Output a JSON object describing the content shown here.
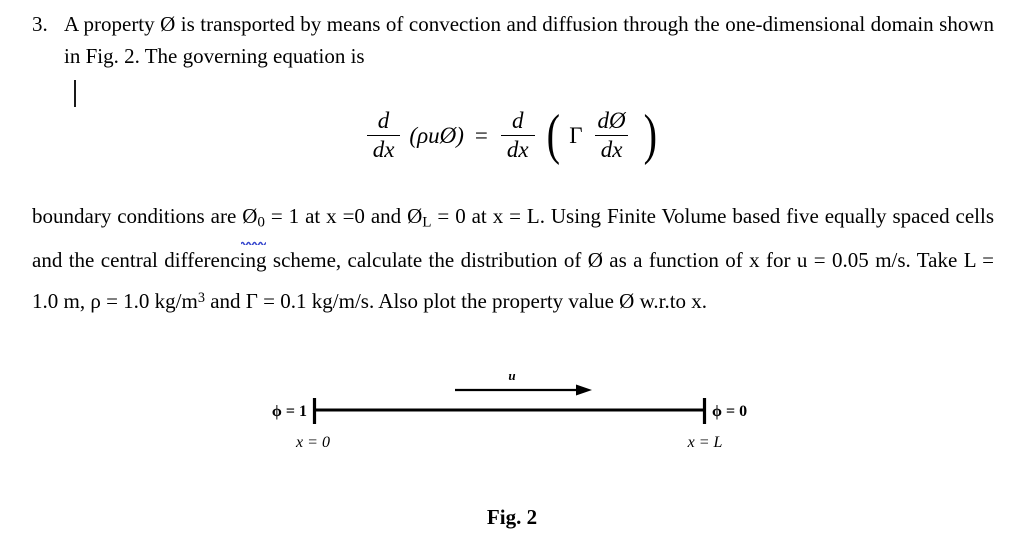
{
  "document": {
    "question_number": "3.",
    "line1": "A property Ø is transported by means of convection and diffusion through the one-dimensional domain shown in Fig. 2. The governing equation is",
    "paragraph_parts": {
      "p1": "boundary conditions are ",
      "phi0_symbol": "Ø",
      "phi0_subscript": "0",
      "p2": " = 1 at x =0 and ",
      "phiL_symbol": "Ø",
      "phiL_subscript": "L",
      "p3": " = 0 at x = L. Using Finite Volume based five equally spaced cells and the central differencing scheme, calculate the distribution of Ø as a function of x for u = 0.05 m/s. Take L = 1.0 m, ρ = 1.0 kg/m",
      "rho_exponent": "3",
      "p4": " and Γ = 0.1 kg/m/s. Also plot the property value Ø w.r.to x."
    },
    "spellcheck_underline_color": "#3344cc",
    "text_color": "#000000",
    "background_color": "#ffffff"
  },
  "equation": {
    "lhs": {
      "frac_num": "d",
      "frac_den": "dx",
      "operand": "(ρuØ)"
    },
    "equals": "=",
    "rhs": {
      "frac_num": "d",
      "frac_den": "dx",
      "open_paren": "(",
      "gamma": "Γ",
      "inner_num": "dØ",
      "inner_den": "dx",
      "close_paren": ")"
    }
  },
  "figure": {
    "left_boundary_label": "ϕ = 1",
    "right_boundary_label": "ϕ = 0",
    "left_axis_label": "x = 0",
    "right_axis_label": "x = L",
    "velocity_label": "u",
    "caption": "Fig. 2",
    "line_color": "#000000"
  }
}
